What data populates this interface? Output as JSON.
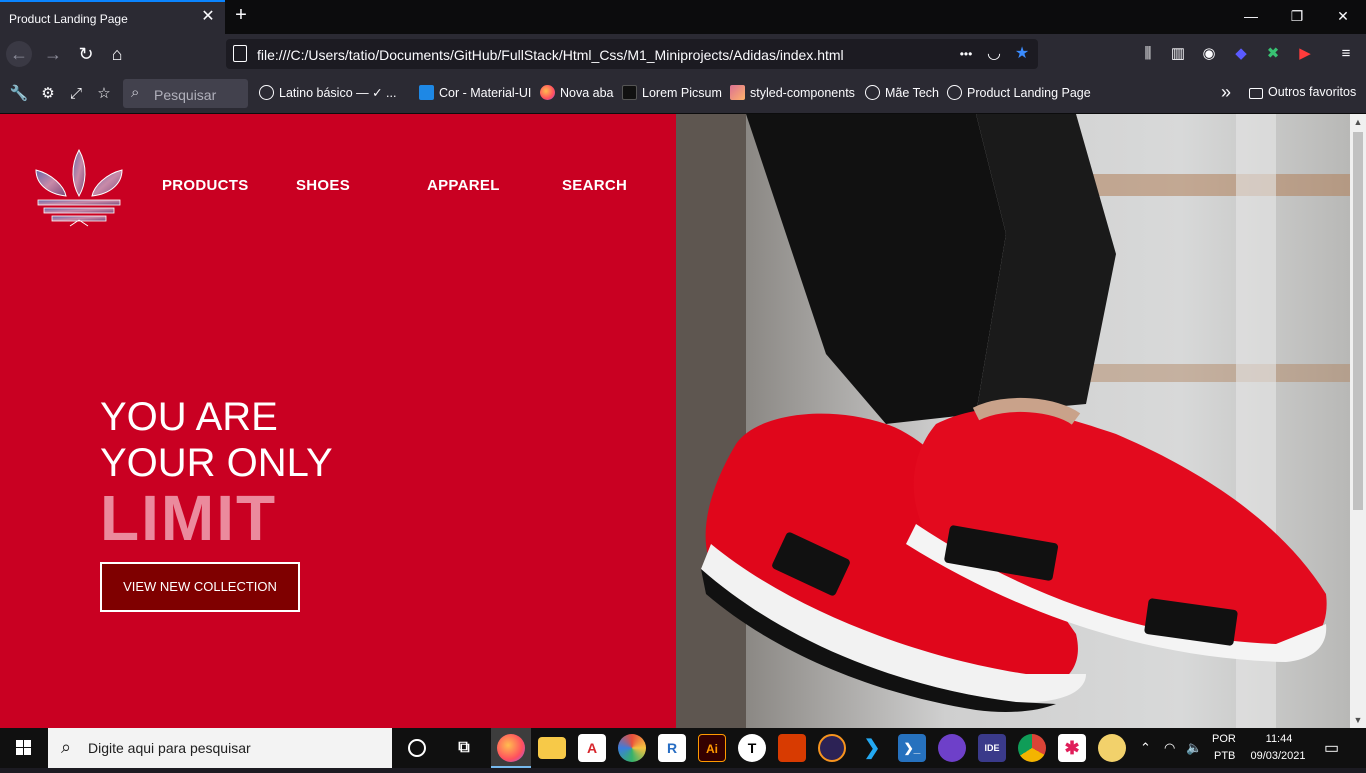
{
  "browser": {
    "tab_title": "Product Landing Page",
    "tab_close": "✕",
    "new_tab": "+",
    "window_controls": {
      "minimize": "—",
      "restore": "❐",
      "close": "✕"
    },
    "url": "file:///C:/Users/tatio/Documents/GitHub/FullStack/Html_Css/M1_Miniprojects/Adidas/index.html",
    "url_more": "•••",
    "bookmarks_search_placeholder": "Pesquisar",
    "bookmarks": [
      {
        "label": "Latino básico — ✓ ...",
        "icon": "globe-icon"
      },
      {
        "label": "Cor - Material-UI",
        "icon": "material-ui-icon"
      },
      {
        "label": "Nova aba",
        "icon": "firefox-icon"
      },
      {
        "label": "Lorem Picsum",
        "icon": "picsum-icon"
      },
      {
        "label": "styled-components",
        "icon": "styled-components-icon"
      },
      {
        "label": "Mãe Tech",
        "icon": "globe-icon"
      },
      {
        "label": "Product Landing Page",
        "icon": "globe-icon"
      }
    ],
    "bookmarks_overflow": "»",
    "other_bookmarks": "Outros favoritos"
  },
  "site": {
    "menu": [
      "PRODUCTS",
      "SHOES",
      "APPAREL",
      "SEARCH"
    ],
    "hero": {
      "line1": "YOU ARE",
      "line2": "YOUR ONLY",
      "highlight": "LIMIT"
    },
    "cta_label": "VIEW NEW COLLECTION",
    "colors": {
      "panel": "#c90022",
      "highlight": "#eb8a9d",
      "button": "#7f0000"
    }
  },
  "taskbar": {
    "search_placeholder": "Digite aqui para pesquisar",
    "apps": [
      "task-view",
      "firefox",
      "file-explorer",
      "adobe-acrobat",
      "davinci-resolve",
      "r-studio",
      "illustrator",
      "typora",
      "office",
      "eclipse",
      "vscode",
      "powershell",
      "github-desktop",
      "bee-ide",
      "chrome",
      "slack",
      "paint"
    ],
    "language_top": "POR",
    "language_bottom": "PTB",
    "time": "11:44",
    "date": "09/03/2021"
  }
}
